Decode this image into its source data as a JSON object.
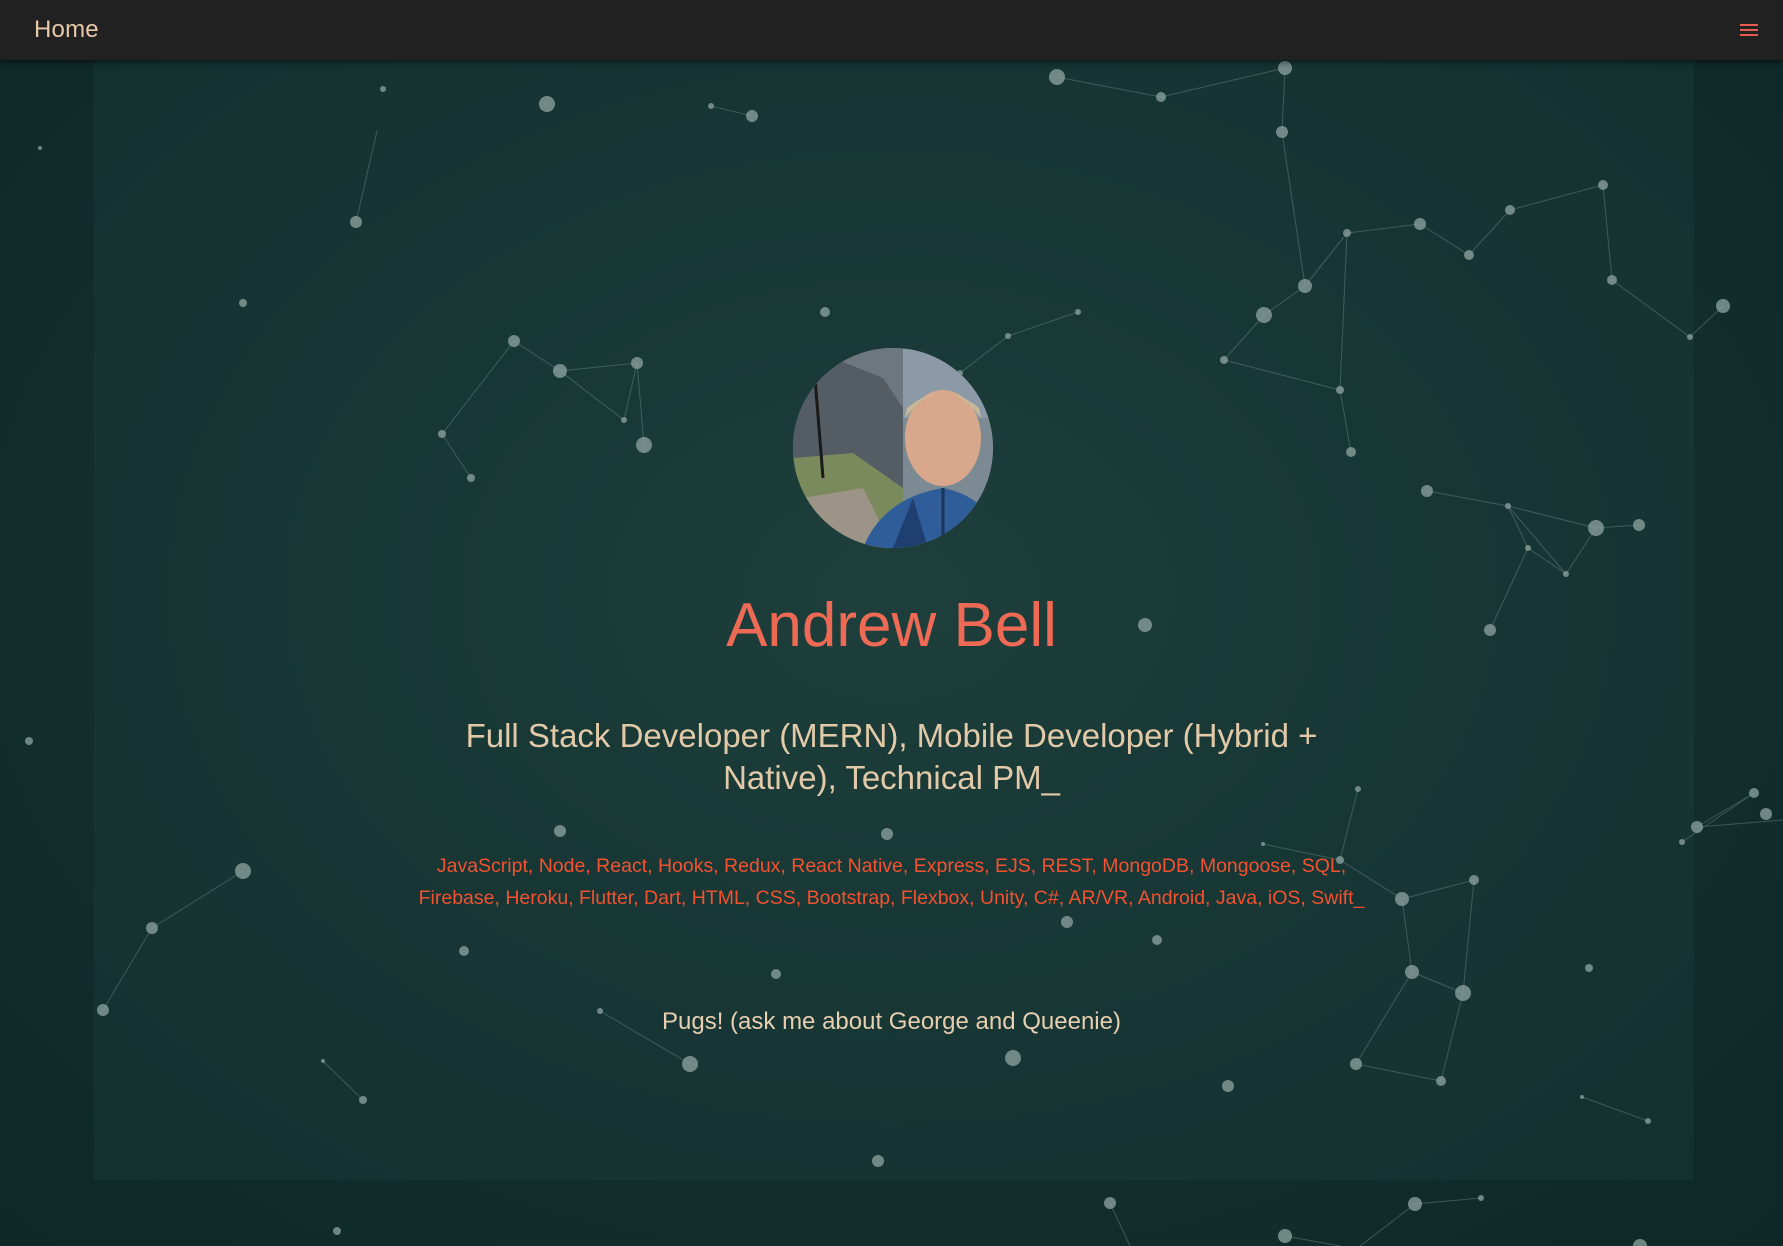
{
  "nav": {
    "brand": "Home",
    "menu_icon": "hamburger-menu-icon",
    "menu_color": "#e65c4f"
  },
  "hero": {
    "name": "Andrew Bell",
    "subtitle": "Full Stack Developer (MERN), Mobile Developer (Hybrid + Native), Technical PM_",
    "skills": "JavaScript, Node, React, Hooks, Redux, React Native, Express, EJS, REST, MongoDB, Mongoose, SQL, Firebase, Heroku, Flutter, Dart, HTML, CSS, Bootstrap, Flexbox, Unity, C#, AR/VR, Android, Java, iOS, Swift_",
    "tagline": "Pugs! (ask me about George and Queenie)",
    "avatar_alt": "profile-photo"
  },
  "colors": {
    "accent": "#ef6a55",
    "skills": "#f2522f",
    "text": "#e2caa9",
    "navbar": "#212121",
    "background": "#0e2a28"
  }
}
